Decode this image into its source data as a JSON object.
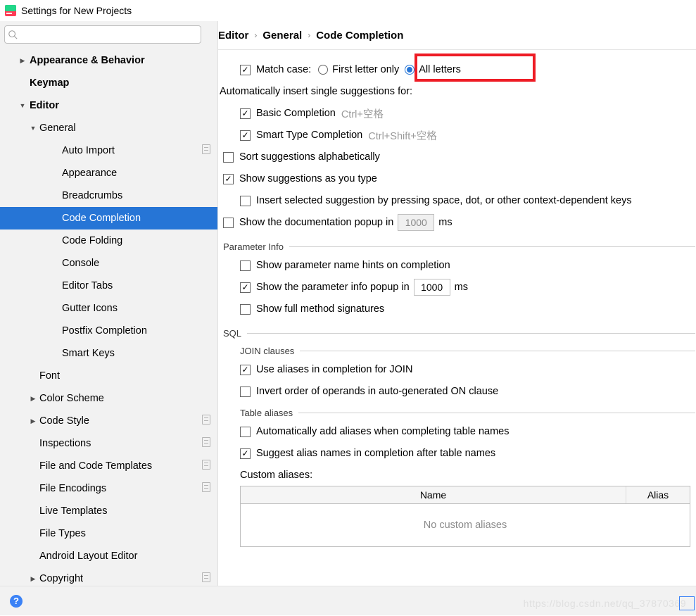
{
  "window_title": "Settings for New Projects",
  "search_placeholder": "",
  "breadcrumb": {
    "a": "Editor",
    "b": "General",
    "c": "Code Completion"
  },
  "sidebar": {
    "items": [
      {
        "label": "Appearance & Behavior",
        "level": 0,
        "bold": true,
        "chev": "right"
      },
      {
        "label": "Keymap",
        "level": 0,
        "bold": true
      },
      {
        "label": "Editor",
        "level": 0,
        "bold": true,
        "chev": "down"
      },
      {
        "label": "General",
        "level": 1,
        "chev": "down"
      },
      {
        "label": "Auto Import",
        "level": 2,
        "sheet": true
      },
      {
        "label": "Appearance",
        "level": 2
      },
      {
        "label": "Breadcrumbs",
        "level": 2
      },
      {
        "label": "Code Completion",
        "level": 2,
        "selected": true
      },
      {
        "label": "Code Folding",
        "level": 2
      },
      {
        "label": "Console",
        "level": 2
      },
      {
        "label": "Editor Tabs",
        "level": 2
      },
      {
        "label": "Gutter Icons",
        "level": 2
      },
      {
        "label": "Postfix Completion",
        "level": 2
      },
      {
        "label": "Smart Keys",
        "level": 2
      },
      {
        "label": "Font",
        "level": 1
      },
      {
        "label": "Color Scheme",
        "level": 1,
        "chev": "right"
      },
      {
        "label": "Code Style",
        "level": 1,
        "chev": "right",
        "sheet": true
      },
      {
        "label": "Inspections",
        "level": 1,
        "sheet": true
      },
      {
        "label": "File and Code Templates",
        "level": 1,
        "sheet": true
      },
      {
        "label": "File Encodings",
        "level": 1,
        "sheet": true
      },
      {
        "label": "Live Templates",
        "level": 1
      },
      {
        "label": "File Types",
        "level": 1
      },
      {
        "label": "Android Layout Editor",
        "level": 1
      },
      {
        "label": "Copyright",
        "level": 1,
        "chev": "right",
        "sheet": true
      }
    ]
  },
  "opts": {
    "match_case_label": "Match case:",
    "first_letter": "First letter only",
    "all_letters": "All letters",
    "auto_insert_heading": "Automatically insert single suggestions for:",
    "basic_completion": "Basic Completion",
    "basic_completion_hint": "Ctrl+空格",
    "smart_completion": "Smart Type Completion",
    "smart_completion_hint": "Ctrl+Shift+空格",
    "sort_alpha": "Sort suggestions alphabetically",
    "show_as_type": "Show suggestions as you type",
    "insert_selected": "Insert selected suggestion by pressing space, dot, or other context-dependent keys",
    "show_doc_popup_pre": "Show the documentation popup in",
    "show_doc_popup_val": "1000",
    "ms": "ms",
    "param_info_section": "Parameter Info",
    "show_param_hints": "Show parameter name hints on completion",
    "show_param_popup_pre": "Show the parameter info popup in",
    "show_param_popup_val": "1000",
    "show_full_sig": "Show full method signatures",
    "sql_section": "SQL",
    "join_section": "JOIN clauses",
    "use_aliases_join": "Use aliases in completion for JOIN",
    "invert_on": "Invert order of operands in auto-generated ON clause",
    "table_aliases_section": "Table aliases",
    "auto_add_aliases": "Automatically add aliases when completing table names",
    "suggest_alias": "Suggest alias names in completion after table names",
    "custom_aliases_label": "Custom aliases:",
    "tbl_name": "Name",
    "tbl_alias": "Alias",
    "tbl_empty": "No custom aliases"
  },
  "watermark": "https://blog.csdn.net/qq_37870369"
}
